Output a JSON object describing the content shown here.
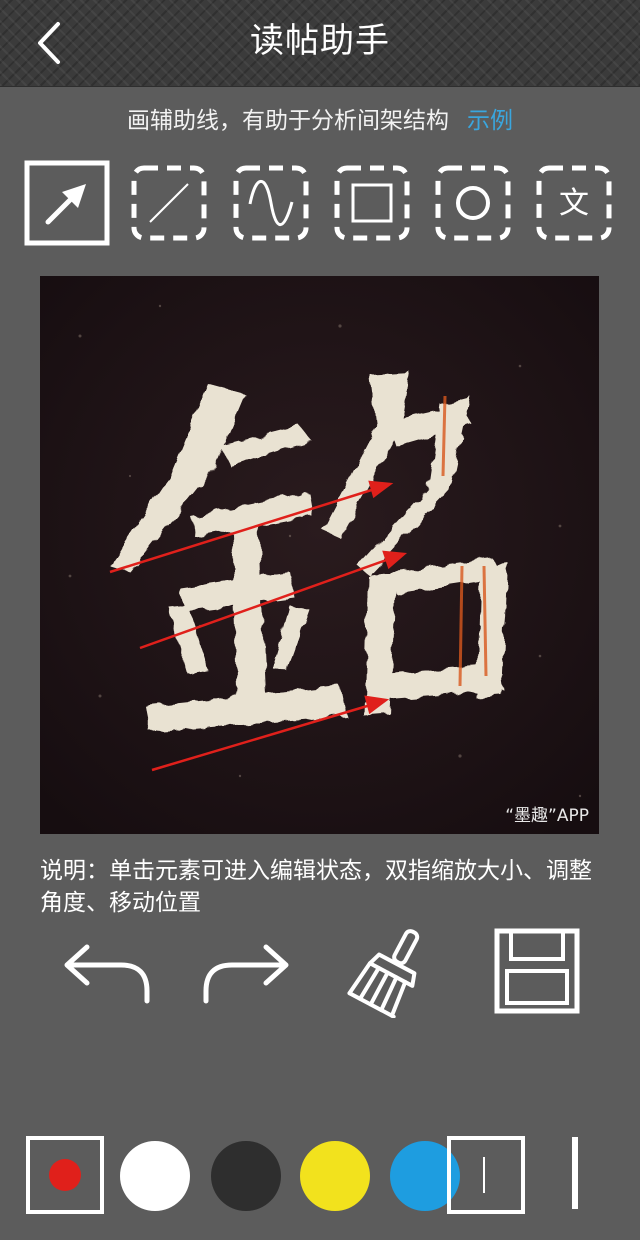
{
  "header": {
    "title": "读帖助手",
    "back_icon": "chevron-left-icon"
  },
  "hint": {
    "text": "画辅助线，有助于分析间架结构",
    "example_link": "示例"
  },
  "tools": [
    {
      "name": "select",
      "icon": "arrow-pointer-icon",
      "selected": true
    },
    {
      "name": "line",
      "icon": "line-icon",
      "selected": false
    },
    {
      "name": "curve",
      "icon": "curve-icon",
      "selected": false
    },
    {
      "name": "rectangle",
      "icon": "rectangle-icon",
      "selected": false
    },
    {
      "name": "circle",
      "icon": "circle-icon",
      "selected": false
    },
    {
      "name": "text",
      "icon": "text-icon",
      "label": "文",
      "selected": false
    }
  ],
  "canvas": {
    "character": "銘",
    "watermark": "“墨趣”APP",
    "annotation_color": "#e0201b"
  },
  "description": "说明：单击元素可进入编辑状态，双指缩放大小、调整角度、移动位置",
  "actions": [
    {
      "name": "undo",
      "icon": "undo-icon"
    },
    {
      "name": "redo",
      "icon": "redo-icon"
    },
    {
      "name": "clear",
      "icon": "broom-icon"
    },
    {
      "name": "save",
      "icon": "floppy-disk-icon"
    }
  ],
  "colors": {
    "accent_link": "#3aa6de",
    "selected_color": "#e0201b",
    "palette": [
      "#ffffff",
      "#2e2e2e",
      "#f2e21d",
      "#1e9de0"
    ]
  },
  "stroke_width_icons": [
    "thin-stroke-icon",
    "thick-stroke-icon"
  ]
}
